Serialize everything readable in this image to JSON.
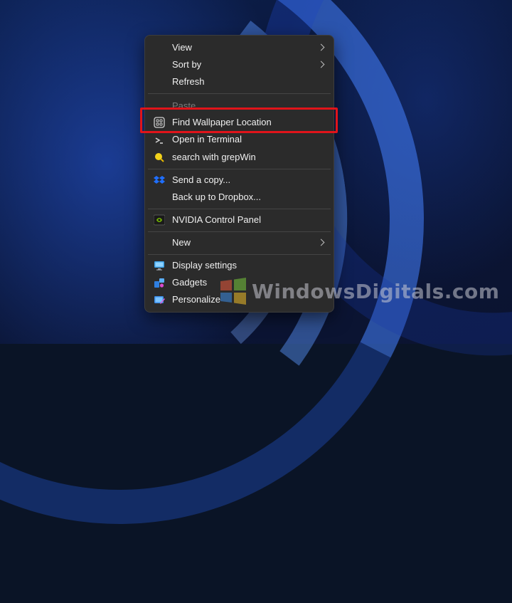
{
  "menu": {
    "items": [
      {
        "label": "View",
        "has_submenu": true
      },
      {
        "label": "Sort by",
        "has_submenu": true
      },
      {
        "label": "Refresh"
      },
      {
        "label": "Paste",
        "disabled": true
      },
      {
        "label": "Find Wallpaper Location",
        "highlighted": true,
        "icon": "wallpaper-grid-icon"
      },
      {
        "label": "Open in Terminal",
        "icon": "terminal-icon"
      },
      {
        "label": "search with grepWin",
        "icon": "grepwin-icon"
      },
      {
        "label": "Send a copy...",
        "icon": "dropbox-icon"
      },
      {
        "label": "Back up to Dropbox..."
      },
      {
        "label": "NVIDIA Control Panel",
        "icon": "nvidia-icon"
      },
      {
        "label": "New",
        "has_submenu": true
      },
      {
        "label": "Display settings",
        "icon": "display-icon"
      },
      {
        "label": "Gadgets",
        "icon": "gadgets-icon"
      },
      {
        "label": "Personalize",
        "icon": "personalize-icon"
      }
    ]
  },
  "highlight_color": "#e0141a",
  "watermark": {
    "text": "WindowsDigitals.com"
  }
}
